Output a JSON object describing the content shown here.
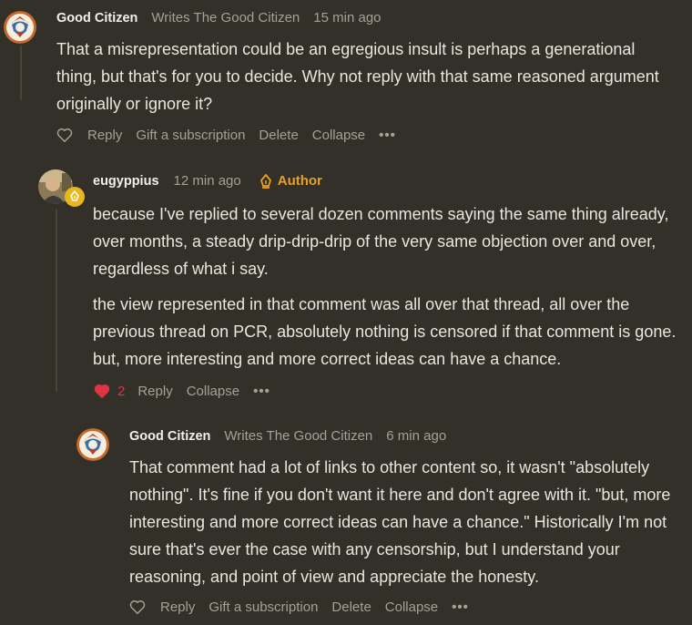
{
  "comments": [
    {
      "author": "Good Citizen",
      "subtitle": "Writes The Good Citizen",
      "time": "15 min ago",
      "paragraphs": [
        "That a misrepresentation could be an egregious insult is perhaps a generational thing, but that's for you to decide. Why not reply with that same reasoned argument originally or ignore it?"
      ],
      "actions": {
        "reply": "Reply",
        "gift": "Gift a subscription",
        "delete": "Delete",
        "collapse": "Collapse",
        "more": "•••"
      }
    },
    {
      "author": "eugyppius",
      "time": "12 min ago",
      "badge": "Author",
      "paragraphs": [
        "because I've replied to several dozen comments saying the same thing already, over months, a steady drip-drip-drip of the very same objection over and over, regardless of what i say.",
        "the view represented in that comment was all over that thread, all over the previous thread on PCR, absolutely nothing is censored if that comment is gone. but, more interesting and more correct ideas can have a chance."
      ],
      "likes": "2",
      "actions": {
        "reply": "Reply",
        "collapse": "Collapse",
        "more": "•••"
      }
    },
    {
      "author": "Good Citizen",
      "subtitle": "Writes The Good Citizen",
      "time": "6 min ago",
      "paragraphs": [
        "That comment had a lot of links to other content so, it wasn't \"absolutely nothing\". It's fine if you don't want it here and don't agree with it. \"but, more interesting and more correct ideas can have a chance.\" Historically I'm not sure that's ever the case with any censorship, but I understand your reasoning, and point of view and appreciate the honesty."
      ],
      "actions": {
        "reply": "Reply",
        "gift": "Gift a subscription",
        "delete": "Delete",
        "collapse": "Collapse",
        "more": "•••"
      }
    }
  ],
  "colors": {
    "background": "#323029",
    "author_badge": "#e9a21d",
    "liked_heart": "#dc3545"
  }
}
